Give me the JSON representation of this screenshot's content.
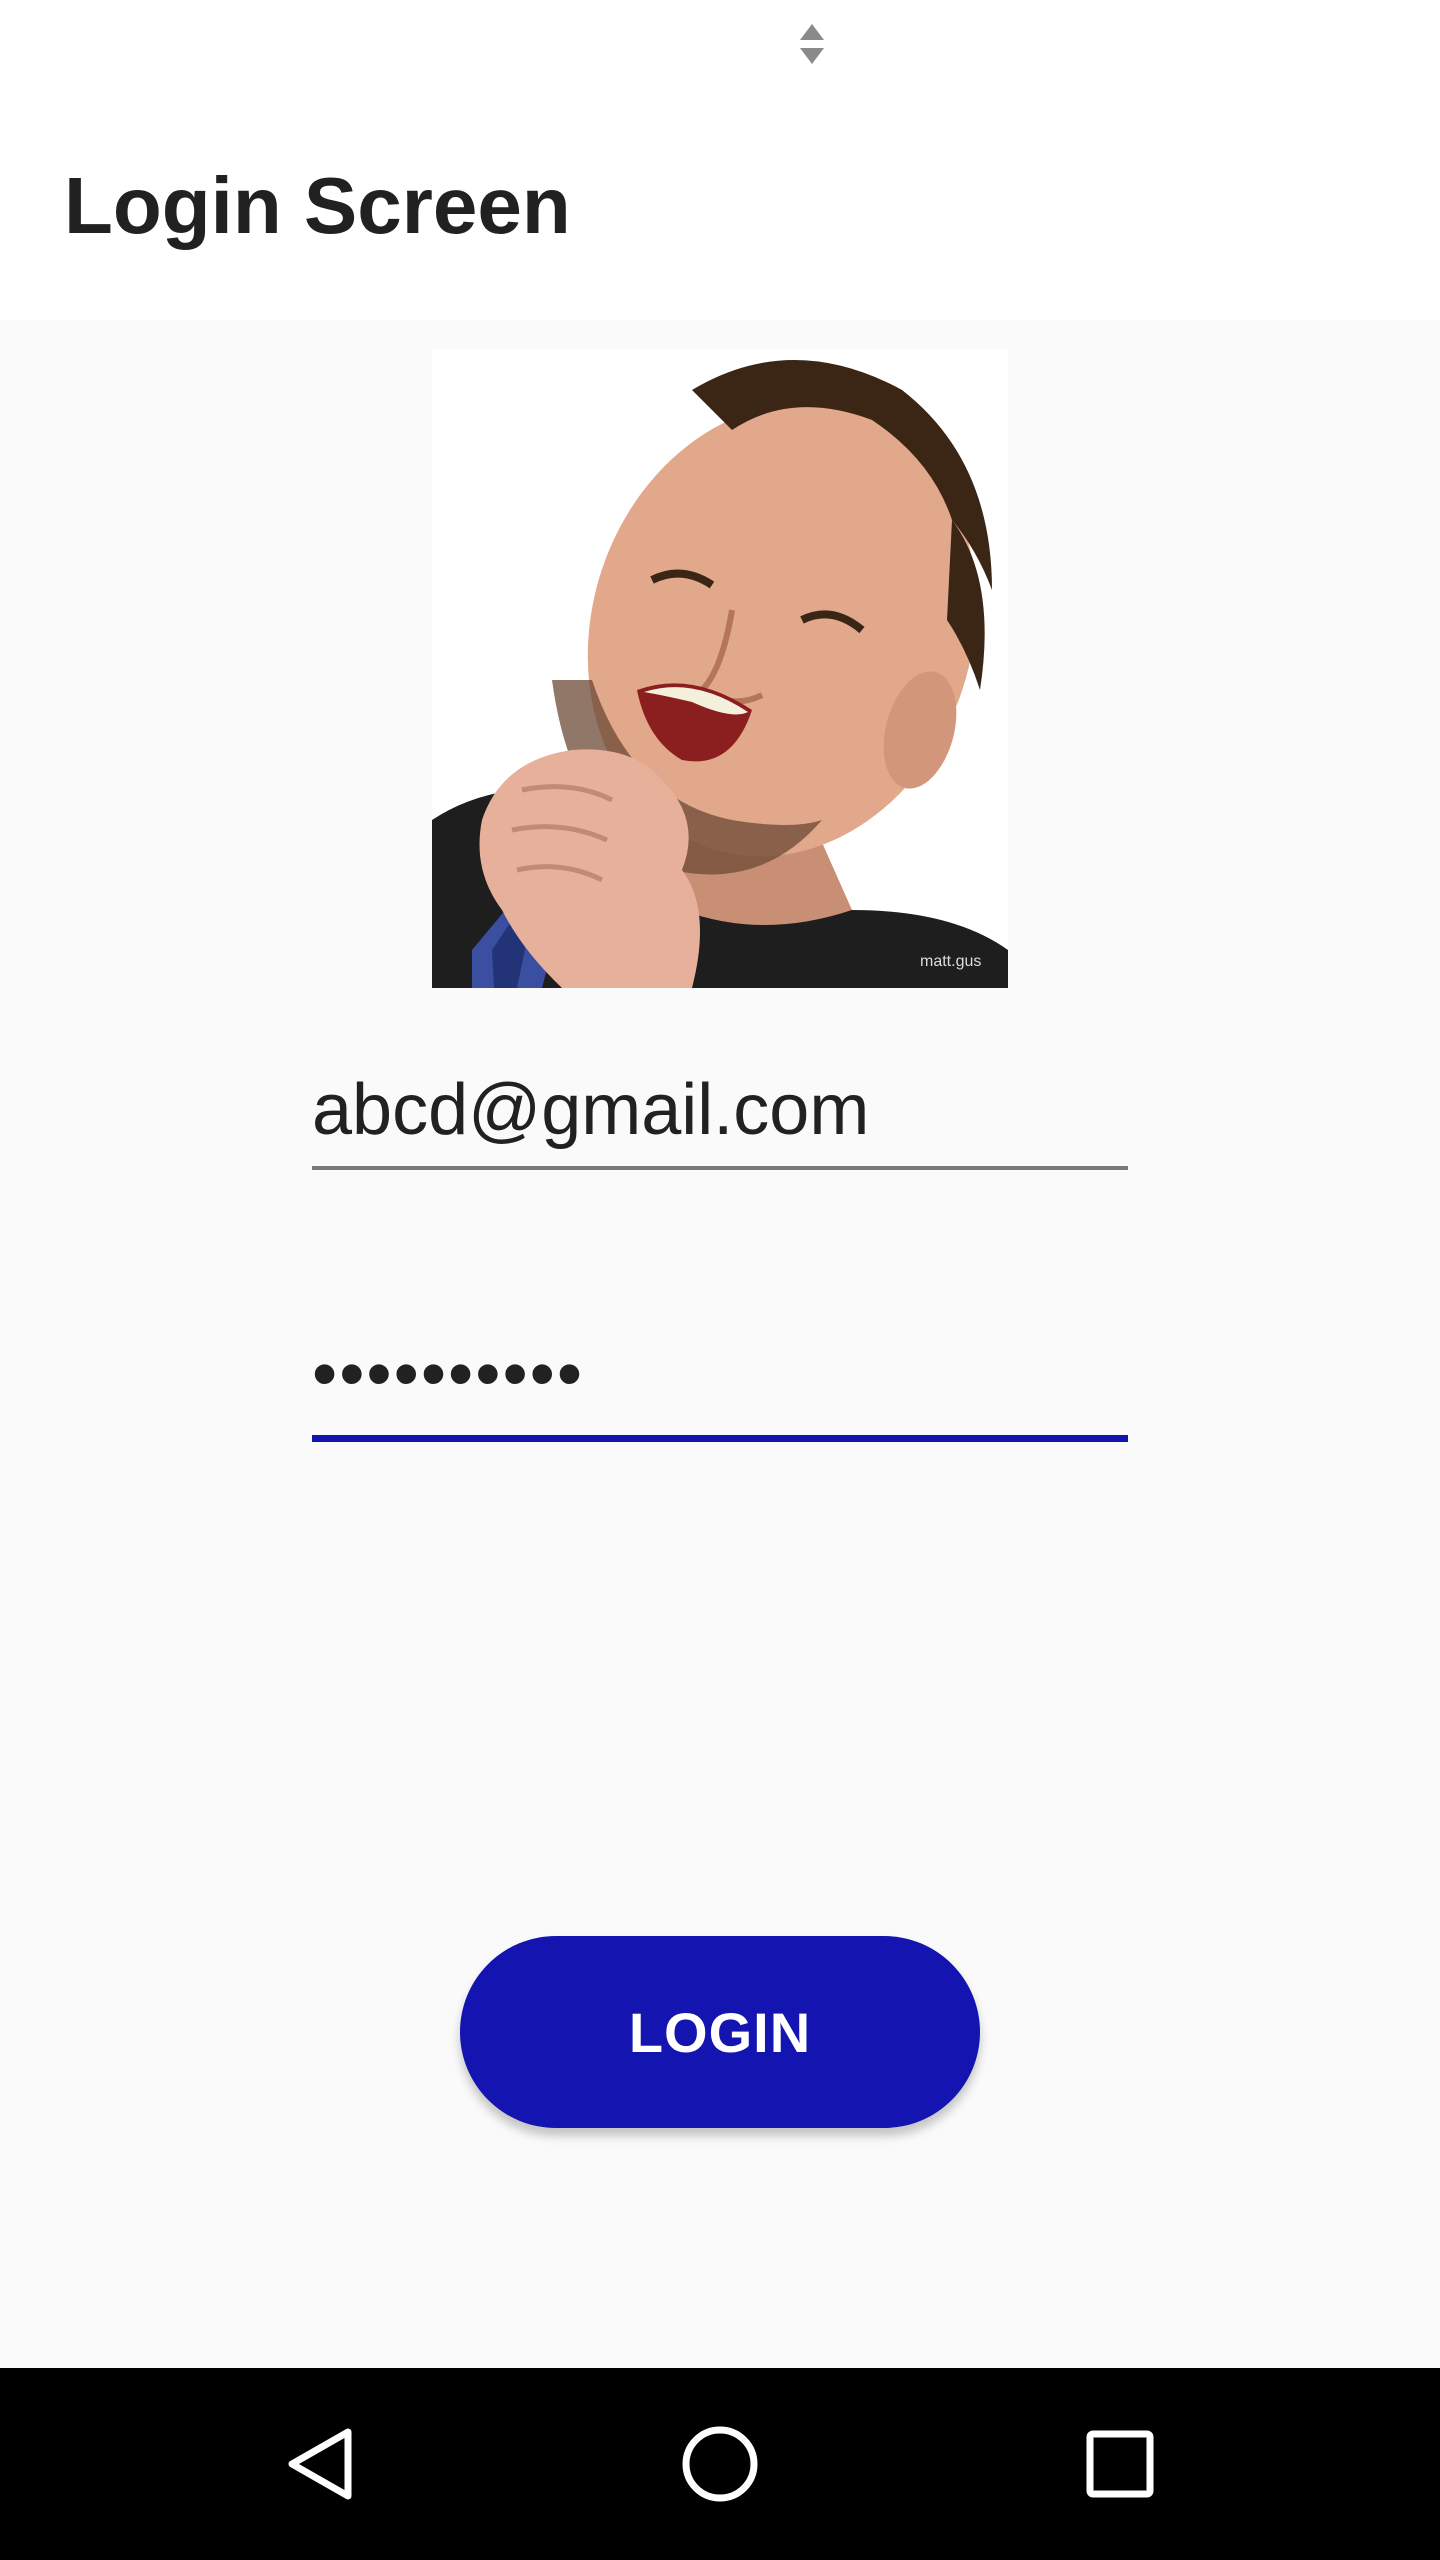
{
  "status_bar": {
    "icon": "sort-arrows-icon"
  },
  "app_bar": {
    "title": "Login Screen"
  },
  "avatar": {
    "icon": "profile-photo",
    "watermark": "matt.gus"
  },
  "form": {
    "email_value": "abcd@gmail.com",
    "password_value": "••••••••••"
  },
  "login_button": {
    "label": "LOGIN",
    "color": "#1414b0"
  },
  "nav_bar": {
    "back_icon": "back-triangle-icon",
    "home_icon": "home-circle-icon",
    "recents_icon": "recents-square-icon"
  },
  "colors": {
    "accent": "#1414b0",
    "background": "#fafafa",
    "app_bar": "#ffffff",
    "text": "#212121"
  }
}
